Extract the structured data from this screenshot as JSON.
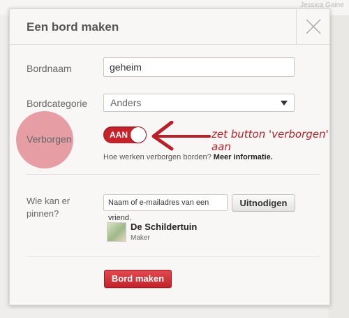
{
  "background": {
    "user_name": "Jessica Gaine"
  },
  "dialog": {
    "title": "Een bord maken",
    "close_icon": "close-icon"
  },
  "form": {
    "board_name": {
      "label": "Bordnaam",
      "value": "geheim"
    },
    "board_category": {
      "label": "Bordcategorie",
      "selected": "Anders"
    },
    "secret": {
      "label": "Verborgen",
      "toggle_label": "AAN",
      "state": "on",
      "help_text": "Hoe werken verborgen borden?",
      "help_link": "Meer informatie."
    },
    "who_can_pin": {
      "label": "Wie kan er pinnen?",
      "invite_placeholder": "Naam of e-mailadres van een vriend.",
      "invite_button": "Uitnodigen",
      "members": [
        {
          "name": "De Schildertuin",
          "role": "Maker"
        }
      ]
    },
    "submit_label": "Bord maken"
  },
  "annotation": {
    "text": "zet button 'verborgen' aan"
  },
  "colors": {
    "accent_red": "#c7222a",
    "highlight_pink": "#de7882",
    "annotation_red": "#b8202a"
  }
}
